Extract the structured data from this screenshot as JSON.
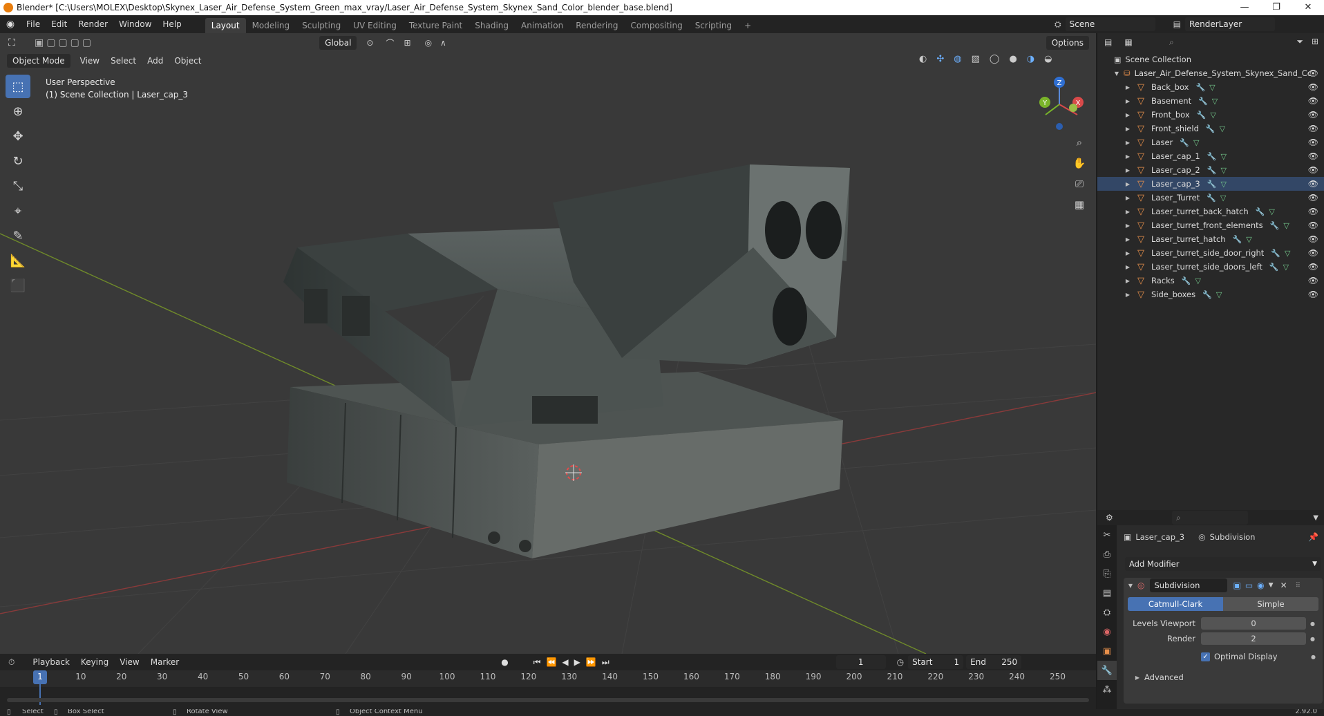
{
  "window": {
    "title": "Blender* [C:\\Users\\MOLEX\\Desktop\\Skynex_Laser_Air_Defense_System_Green_max_vray/Laser_Air_Defense_System_Skynex_Sand_Color_blender_base.blend]",
    "minimize": "—",
    "maximize": "❐",
    "close": "✕"
  },
  "menu": [
    "File",
    "Edit",
    "Render",
    "Window",
    "Help"
  ],
  "workspaces": [
    "Layout",
    "Modeling",
    "Sculpting",
    "UV Editing",
    "Texture Paint",
    "Shading",
    "Animation",
    "Rendering",
    "Compositing",
    "Scripting"
  ],
  "workspace_add": "+",
  "scene": {
    "name": "Scene",
    "view_layer": "RenderLayer"
  },
  "viewport": {
    "mode": "Object Mode",
    "menus": [
      "View",
      "Select",
      "Add",
      "Object"
    ],
    "orientation": "Global",
    "options": "Options",
    "overlay_title": "User Perspective",
    "overlay_sub": "(1) Scene Collection | Laser_cap_3",
    "gizmo": {
      "z": "Z",
      "y": "Y",
      "x": "X"
    }
  },
  "tools": [
    "select-box",
    "cursor",
    "move",
    "rotate",
    "scale",
    "transform",
    "annotate",
    "measure",
    "add-cube"
  ],
  "outliner": {
    "root": "Scene Collection",
    "collection": "Laser_Air_Defense_System_Skynex_Sand_Cc",
    "items": [
      {
        "name": "Back_box"
      },
      {
        "name": "Basement"
      },
      {
        "name": "Front_box"
      },
      {
        "name": "Front_shield"
      },
      {
        "name": "Laser"
      },
      {
        "name": "Laser_cap_1"
      },
      {
        "name": "Laser_cap_2"
      },
      {
        "name": "Laser_cap_3"
      },
      {
        "name": "Laser_Turret"
      },
      {
        "name": "Laser_turret_back_hatch"
      },
      {
        "name": "Laser_turret_front_elements"
      },
      {
        "name": "Laser_turret_hatch"
      },
      {
        "name": "Laser_turret_side_door_right"
      },
      {
        "name": "Laser_turret_side_doors_left"
      },
      {
        "name": "Racks"
      },
      {
        "name": "Side_boxes"
      }
    ]
  },
  "properties": {
    "object": "Laser_cap_3",
    "modifier_context": "Subdivision",
    "add_modifier": "Add Modifier",
    "modifier_name": "Subdivision",
    "method_active": "Catmull-Clark",
    "method_other": "Simple",
    "levels_viewport_label": "Levels Viewport",
    "levels_viewport": "0",
    "render_label": "Render",
    "render": "2",
    "optimal_display": "Optimal Display",
    "advanced": "Advanced"
  },
  "timeline": {
    "menus": [
      "Playback",
      "Keying",
      "View",
      "Marker"
    ],
    "current_frame": "1",
    "start_label": "Start",
    "start": "1",
    "end_label": "End",
    "end": "250",
    "ruler": [
      "1",
      "10",
      "20",
      "30",
      "40",
      "50",
      "60",
      "70",
      "80",
      "90",
      "100",
      "110",
      "120",
      "130",
      "140",
      "150",
      "160",
      "170",
      "180",
      "190",
      "200",
      "210",
      "220",
      "230",
      "240",
      "250"
    ]
  },
  "status": {
    "select": "Select",
    "box_select": "Box Select",
    "rotate_view": "Rotate View",
    "context_menu": "Object Context Menu",
    "version": "2.92.0"
  }
}
